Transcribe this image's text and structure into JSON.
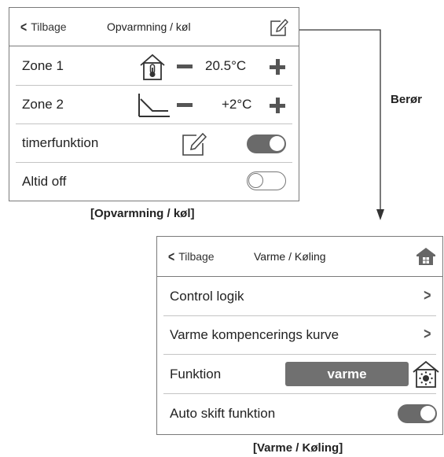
{
  "screen1": {
    "back_label": "Tilbage",
    "title": "Opvarmning / køl",
    "header_icon": "edit-icon",
    "rows": [
      {
        "label": "Zone 1",
        "icon": "thermometer-house-icon",
        "value": "20.5°C"
      },
      {
        "label": "Zone 2",
        "icon": "curve-icon",
        "value": "+2°C"
      },
      {
        "label": "timerfunktion",
        "icon": "edit-icon",
        "toggle": "on"
      },
      {
        "label": "Altid off",
        "toggle": "off"
      }
    ],
    "caption": "[Opvarmning / køl]"
  },
  "touch_label": "Berør",
  "screen2": {
    "back_label": "Tilbage",
    "title": "Varme / Køling",
    "header_icon": "home-icon",
    "rows": [
      {
        "label": "Control logik",
        "chevron": true
      },
      {
        "label": "Varme kompencerings kurve",
        "chevron": true
      },
      {
        "label": "Funktion",
        "button": "varme",
        "icon": "sun-house-icon"
      },
      {
        "label": "Auto skift funktion",
        "toggle": "on"
      }
    ],
    "caption": "[Varme / Køling]"
  },
  "colors": {
    "border": "#7a7a7a",
    "dark_gray": "#6a6a6a",
    "divider": "#c4c4c4"
  }
}
